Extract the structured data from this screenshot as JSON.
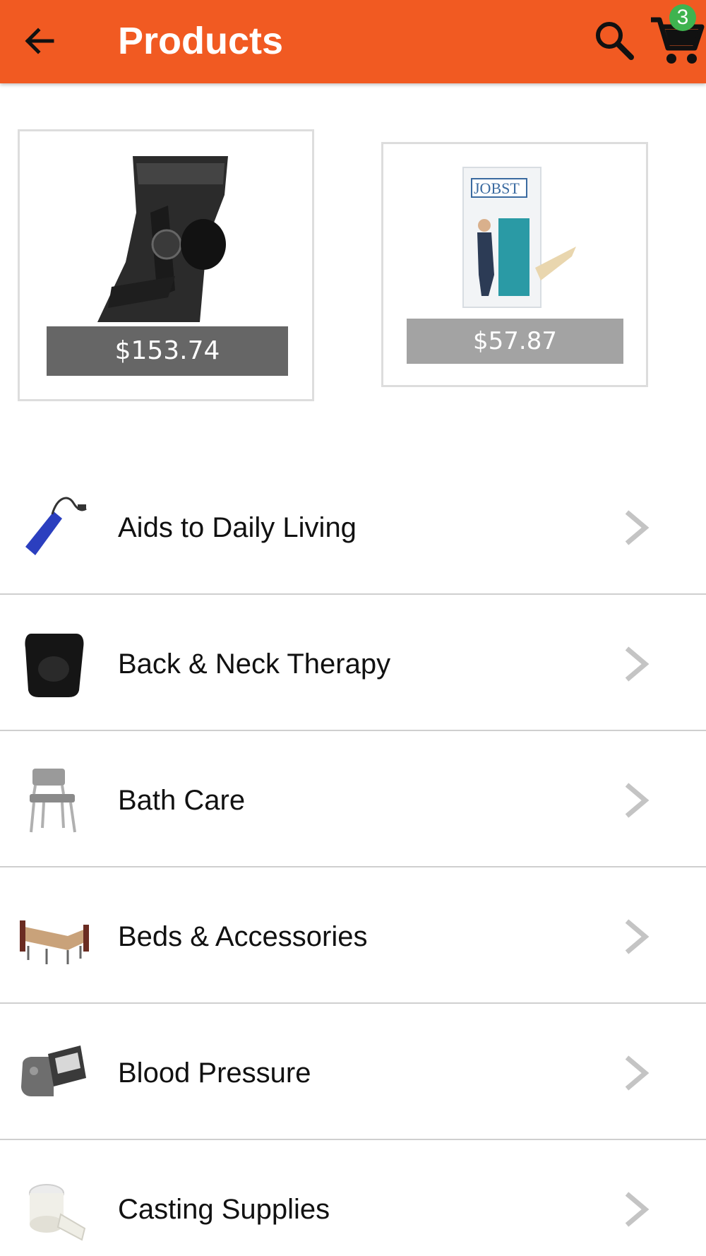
{
  "header": {
    "title": "Products",
    "back_icon": "arrow-back-icon",
    "search_icon": "search-icon",
    "cart_icon": "cart-icon",
    "cart_count": "3",
    "bar_color": "#f15a22",
    "badge_color": "#3fb34f"
  },
  "featured": [
    {
      "image_icon": "knee-brace-icon",
      "price": "$153.74"
    },
    {
      "image_icon": "compression-stockings-box-icon",
      "logo": "JOBST",
      "price": "$57.87"
    }
  ],
  "categories": [
    {
      "label": "Aids to Daily Living",
      "icon": "reacher-grabber-icon"
    },
    {
      "label": "Back & Neck Therapy",
      "icon": "back-cushion-icon"
    },
    {
      "label": "Bath Care",
      "icon": "shower-chair-icon"
    },
    {
      "label": "Beds & Accessories",
      "icon": "hospital-bed-icon"
    },
    {
      "label": "Blood Pressure",
      "icon": "blood-pressure-monitor-icon"
    },
    {
      "label": "Casting Supplies",
      "icon": "cast-padding-roll-icon"
    }
  ]
}
